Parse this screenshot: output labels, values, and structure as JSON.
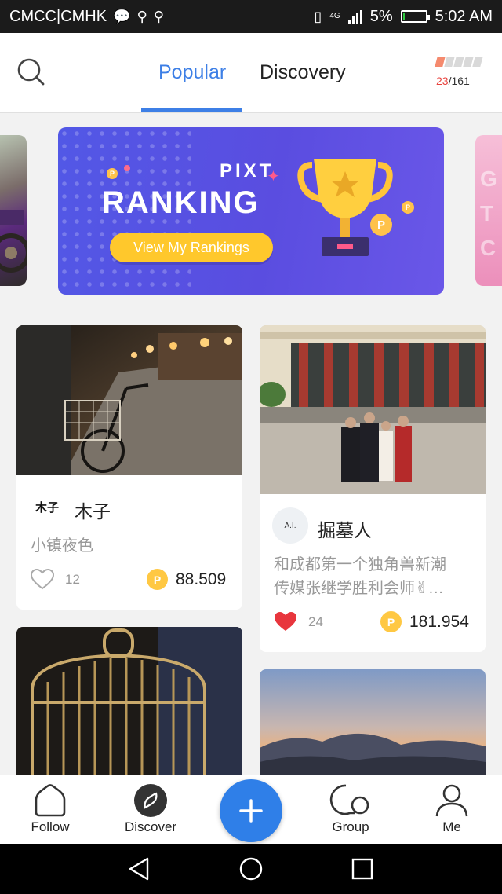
{
  "status_bar": {
    "carrier": "CMCC|CMHK",
    "network": "4G",
    "battery": "5%",
    "time": "5:02 AM"
  },
  "header": {
    "tabs": [
      {
        "label": "Popular",
        "active": true
      },
      {
        "label": "Discovery",
        "active": false
      }
    ],
    "task_progress": {
      "current": "23",
      "total": "/161",
      "fraction": 0.14
    },
    "accent_color": "#3d7fe6"
  },
  "banner": {
    "brand": "PIXT",
    "title": "RANKING",
    "button_label": "View My Rankings",
    "coin_symbol": "P"
  },
  "posts": [
    {
      "author": "木子",
      "avatar_text": "木子",
      "description": "小镇夜色",
      "likes": "12",
      "liked": false,
      "reward": "88.509"
    },
    {
      "author": "掘墓人",
      "avatar_text": "A.I.",
      "description_lines": [
        "和成都第一个独角兽新潮",
        "传媒张继学胜利会师✌…"
      ],
      "likes": "24",
      "liked": true,
      "reward": "181.954"
    }
  ],
  "bottom_nav": [
    {
      "label": "Follow",
      "icon": "home-outline-icon"
    },
    {
      "label": "Discover",
      "icon": "compass-icon"
    },
    {
      "label": "",
      "icon": "plus-icon"
    },
    {
      "label": "Group",
      "icon": "group-bubbles-icon"
    },
    {
      "label": "Me",
      "icon": "person-icon"
    }
  ]
}
